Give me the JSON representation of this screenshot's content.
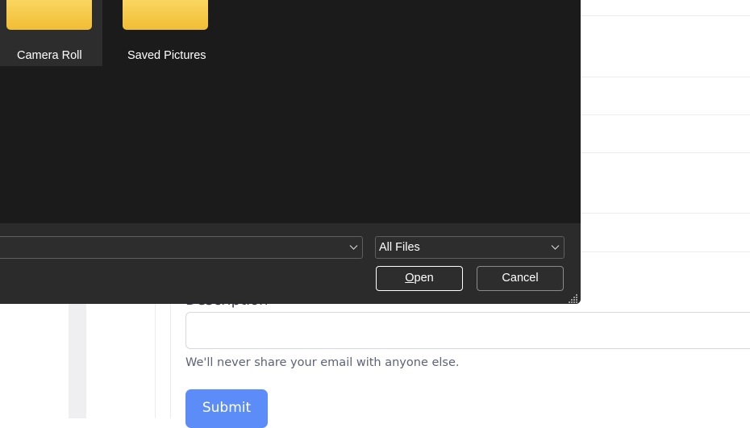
{
  "dialog": {
    "items": [
      {
        "label": "Camera Roll",
        "icon": "folder-icon",
        "selected": true
      },
      {
        "label": "Saved Pictures",
        "icon": "folder-icon",
        "selected": false
      }
    ],
    "filename_value": "",
    "filetype_value": "All Files",
    "open_label": "Open",
    "cancel_label": "Cancel"
  },
  "form": {
    "description_label": "Description",
    "description_value": "",
    "help_text": "We'll never share your email with anyone else.",
    "submit_label": "Submit"
  },
  "colors": {
    "dialog_bg": "#1b1b1b",
    "dialog_footer": "#2b2b2b",
    "folder": "#f5c644",
    "submit": "#5b8cf7"
  }
}
